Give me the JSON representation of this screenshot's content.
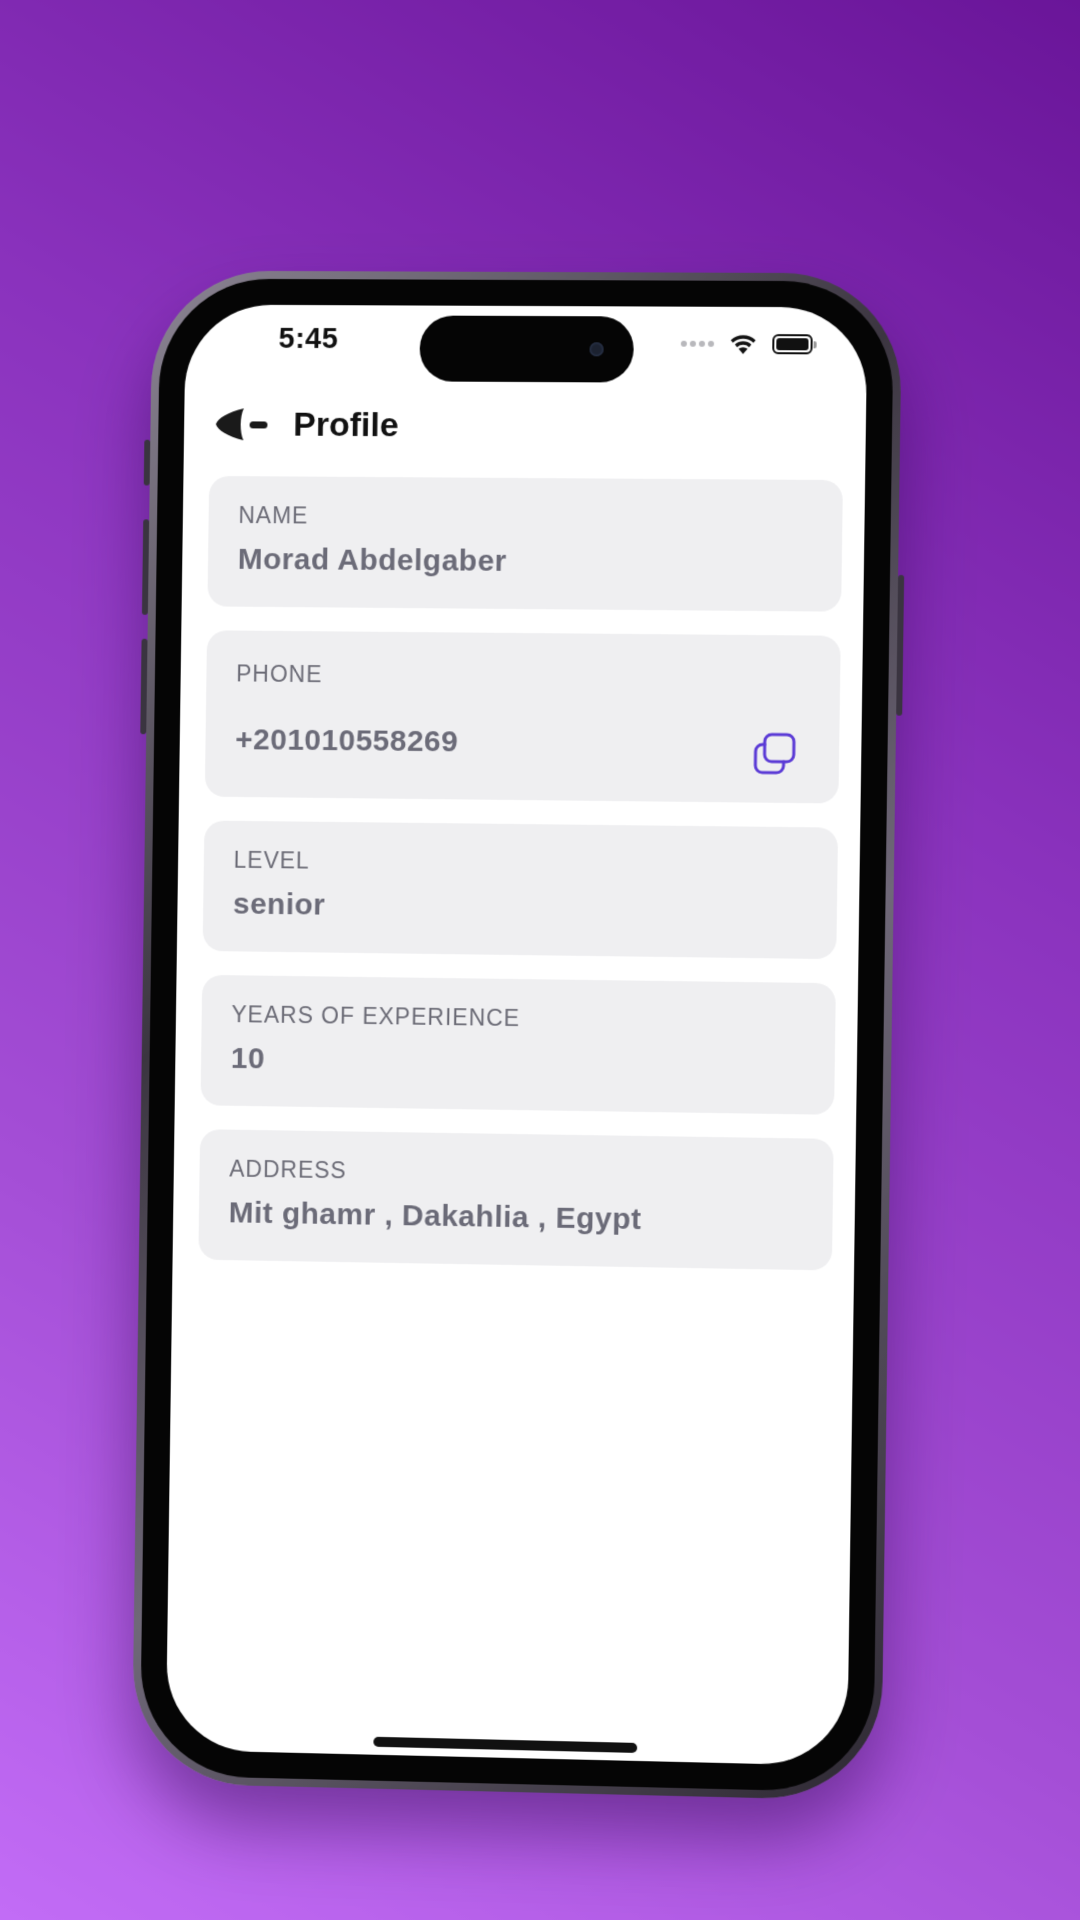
{
  "status_bar": {
    "time": "5:45"
  },
  "header": {
    "title": "Profile"
  },
  "fields": [
    {
      "label": "NAME",
      "value": "Morad Abdelgaber"
    },
    {
      "label": "PHONE",
      "value": "+201010558269"
    },
    {
      "label": "LEVEL",
      "value": "senior"
    },
    {
      "label": "YEARS OF EXPERIENCE",
      "value": "10"
    },
    {
      "label": "ADDRESS",
      "value": "Mit ghamr , Dakahlia , Egypt"
    }
  ],
  "icons": {
    "back": "back-arrow-icon",
    "copy": "copy-icon",
    "wifi": "wifi-icon",
    "battery": "battery-icon",
    "signal": "signal-icon"
  },
  "colors": {
    "background_top": "#6a1599",
    "background_bottom": "#c26cf6",
    "card_background": "#efeff1",
    "label_text": "#6b6b76",
    "value_text": "#6b6b78",
    "accent": "#5b3bd6"
  }
}
